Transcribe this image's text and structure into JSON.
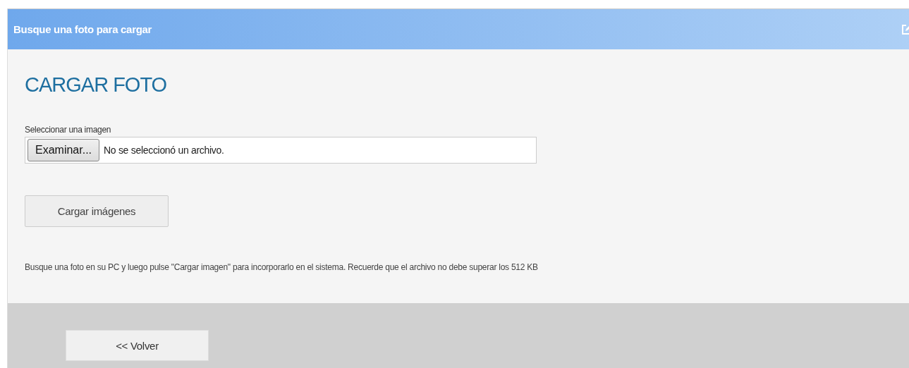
{
  "panel": {
    "title": "Busque una foto para cargar"
  },
  "form": {
    "heading": "CARGAR FOTO",
    "file_label": "Seleccionar una imagen",
    "browse_button": "Examinar...",
    "file_status": "No se seleccionó un archivo.",
    "upload_button": "Cargar imágenes",
    "help_text": "Busque una foto en su PC y luego pulse \"Cargar imagen\" para incorporarlo en el sistema. Recuerde que el archivo no debe superar los 512 KB"
  },
  "footer": {
    "back_button": "<< Volver"
  }
}
